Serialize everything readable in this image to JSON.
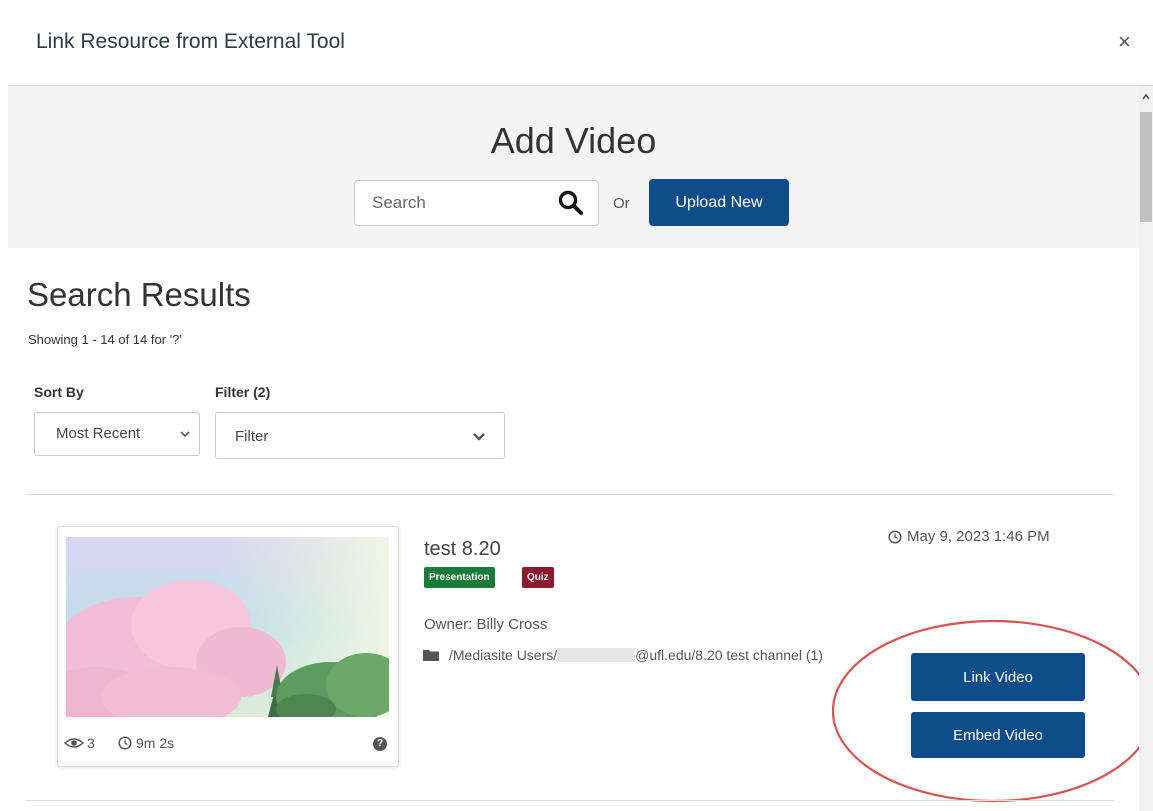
{
  "dialog": {
    "title": "Link Resource from External Tool",
    "close_label": "×"
  },
  "header": {
    "title": "Add Video",
    "search_placeholder": "Search",
    "or_label": "Or",
    "upload_label": "Upload New"
  },
  "results": {
    "heading": "Search Results",
    "showing": "Showing 1 - 14 of 14 for '?'"
  },
  "controls": {
    "sort_label": "Sort By",
    "sort_value": "Most Recent",
    "filter_label": "Filter (2)",
    "filter_value": "Filter"
  },
  "item": {
    "title": "test 8.20",
    "badges": [
      "Presentation",
      "Quiz"
    ],
    "owner": "Owner: Billy Cross",
    "folder_before": "/Mediasite Users/",
    "folder_after": "@ufl.edu/8.20 test channel (1)",
    "date": "May 9, 2023 1:46 PM",
    "views": "3",
    "duration": "9m 2s",
    "help_glyph": "?",
    "link_label": "Link Video",
    "embed_label": "Embed Video"
  },
  "colors": {
    "primary_button": "#0f4d8a",
    "badge_presentation": "#1a7a3a",
    "badge_quiz": "#8b1a2f",
    "annotation_circle": "#d9534f"
  },
  "icons": [
    "close-icon",
    "search-icon",
    "chevron-down-icon",
    "eye-icon",
    "clock-icon",
    "help-icon",
    "folder-icon",
    "scroll-up-icon"
  ]
}
